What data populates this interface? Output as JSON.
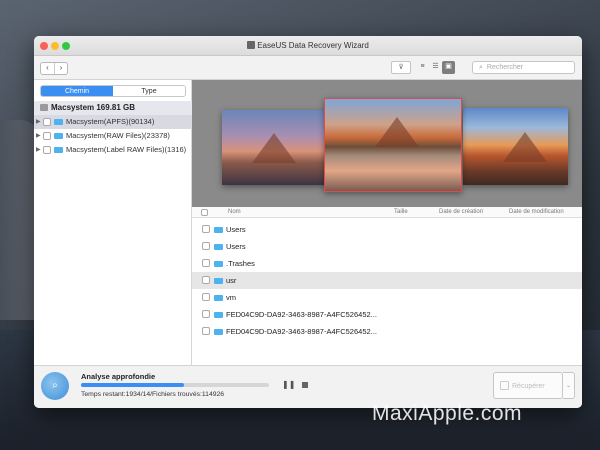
{
  "window": {
    "title": "EaseUS Data Recovery Wizard"
  },
  "toolbar": {
    "back_glyph": "‹",
    "forward_glyph": "›",
    "filter_glyph": "⊽",
    "view_list_glyph": "≡",
    "view_detail_glyph": "☰",
    "view_cover_glyph": "▣",
    "search_placeholder": "Rechercher",
    "search_glyph": "⌕"
  },
  "sidebar": {
    "tabs": [
      {
        "label": "Chemin",
        "selected": true
      },
      {
        "label": "Type",
        "selected": false
      }
    ],
    "root_label": "Macsystem 169.81 GB",
    "items": [
      {
        "label": "Macsystem(APFS)(90134)"
      },
      {
        "label": "Macsystem(RAW Files)(23378)"
      },
      {
        "label": "Macsystem(Label RAW Files)(1316)"
      }
    ]
  },
  "file_list": {
    "columns": [
      "Nom",
      "Taille",
      "Date de création",
      "Date de modification"
    ],
    "rows": [
      {
        "label": "Users"
      },
      {
        "label": "Users"
      },
      {
        "label": ".Trashes"
      },
      {
        "label": "usr"
      },
      {
        "label": "vm"
      },
      {
        "label": "FED04C9D-DA92-3463-8987-A4FC526452..."
      },
      {
        "label": "FED04C9D-DA92-3463-8987-A4FC526452..."
      }
    ]
  },
  "status": {
    "scan_title": "Analyse approfondie",
    "scan_info": "Temps restant:1934/14/Fichiers trouvés:114926",
    "progress": 0.55,
    "scan_glyph": "⌕",
    "pause_glyph": "❚❚"
  },
  "actions": {
    "recover_label": "Récupérer",
    "dropdown_glyph": "⌄"
  },
  "watermark": "MaxiApple.com",
  "colors": {
    "accent": "#3b8ef2",
    "folder": "#4fb1ef",
    "selection_border": "#e04a4a"
  }
}
